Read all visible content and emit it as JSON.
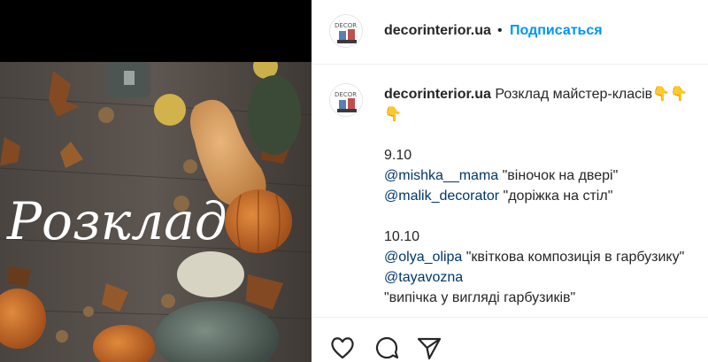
{
  "post": {
    "username": "decorinterior.ua",
    "dot": "•",
    "follow_label": "Подписаться",
    "avatar_logo_text": "DECOR",
    "image_overlay_text": "Розклад"
  },
  "caption": {
    "username": "decorinterior.ua",
    "intro": "Розклад майстер-класів👇👇",
    "intro_cont": "👇",
    "date1": "9.10",
    "m1_handle": "@mishka__mama",
    "m1_text": " \"віночок на двері\"",
    "m2_handle": "@malik_decorator",
    "m2_text": " \"доріжка на стіл\"",
    "date2": "10.10",
    "m3_handle": "@olya_olipa",
    "m3_text": " \"квіткова композиція в гарбузику\"",
    "m4_handle": "@tayavozna",
    "m4_text": "\"випічка у вигляді гарбузиків\""
  },
  "icons": [
    "heart-icon",
    "comment-icon",
    "share-icon"
  ]
}
